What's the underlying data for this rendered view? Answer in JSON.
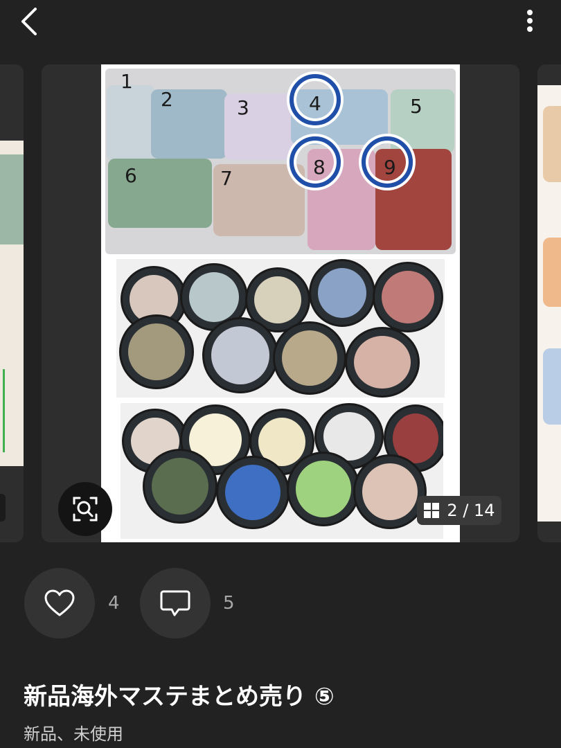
{
  "photo": {
    "tape_numbers": [
      "1",
      "2",
      "3",
      "4",
      "5",
      "6",
      "7",
      "8",
      "9"
    ]
  },
  "gallery": {
    "page_counter": "2 / 14"
  },
  "actions": {
    "like_count": "4",
    "comment_count": "5"
  },
  "item": {
    "title": "新品海外マステまとめ売り ⑤",
    "condition": "新品、未使用"
  },
  "colors": {
    "background": "#222222",
    "card": "#2e2e2e",
    "ring": "#1f4fa8"
  }
}
